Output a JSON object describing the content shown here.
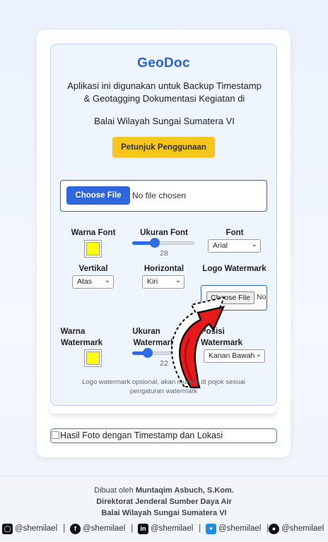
{
  "app": {
    "title": "GeoDoc",
    "description_line1": "Aplikasi ini digunakan untuk Backup Timestamp",
    "description_line2": "& Geotagging Dokumentasi Kegiatan di",
    "description_line3": "Balai Wilayah Sungai Sumatera VI",
    "guide_button": "Petunjuk Penggunaan"
  },
  "upload": {
    "button_label": "Choose File",
    "status": "No file chosen"
  },
  "settings": {
    "font_color_label": "Warna Font",
    "font_color": "#ffff00",
    "font_size_label": "Ukuran Font",
    "font_size_value": "28",
    "font_size_fraction": 0.36,
    "font_label": "Font",
    "font_value": "Arial",
    "vertical_label": "Vertikal",
    "vertical_value": "Atas",
    "horizontal_label": "Horizontal",
    "horizontal_value": "Kiri",
    "logo_label": "Logo Watermark",
    "logo_button": "Choose File",
    "logo_status": "No file chosen",
    "wm_color_label_1": "Warna",
    "wm_color_label_2": "Watermark",
    "wm_color": "#ffff00",
    "wm_size_label_1": "Ukuran",
    "wm_size_label_2": "Watermark",
    "wm_size_value": "22",
    "wm_size_fraction": 0.28,
    "wm_pos_label_1": "Posisi",
    "wm_pos_label_2": "Watermark",
    "wm_pos_value": "Kanan Bawah",
    "note_line1": "Logo watermark opsional, akan muncul di pojok sesuai",
    "note_line2": "pengaturan watermark"
  },
  "result": {
    "image_alt": "Hasil Foto dengan Timestamp dan Lokasi"
  },
  "footer": {
    "prefix": "Dibuat oleh ",
    "author": "Muntaqim Asbuch, S.Kom.",
    "org1": "Direktorat Jenderal Sumber Daya Air",
    "org2": "Balai Wilayah Sungai Sumatera VI",
    "socials": [
      {
        "icon": "instagram-icon",
        "handle": "@shemilael"
      },
      {
        "icon": "facebook-icon",
        "handle": "@shemilael"
      },
      {
        "icon": "linkedin-icon",
        "handle": "@shemilael"
      },
      {
        "icon": "twitter-icon",
        "handle": "@shemilael"
      },
      {
        "icon": "github-icon",
        "handle": "@shemilael"
      }
    ],
    "separator": "|"
  }
}
